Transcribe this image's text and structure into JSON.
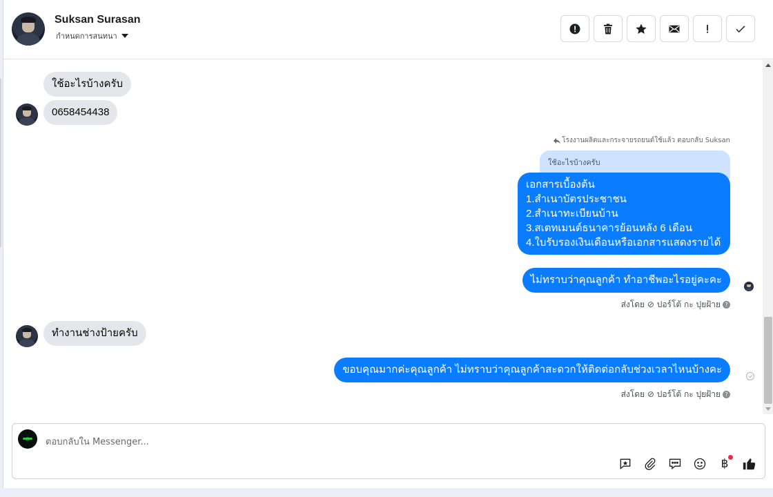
{
  "contact": {
    "name": "Suksan Surasan",
    "subtitle": "กำหนดการสนทนา"
  },
  "toolbar": [
    {
      "name": "report-icon",
      "label": "!"
    },
    {
      "name": "trash-icon",
      "label": ""
    },
    {
      "name": "star-icon",
      "label": ""
    },
    {
      "name": "mail-icon",
      "label": ""
    },
    {
      "name": "exclamation-icon",
      "label": "!"
    },
    {
      "name": "check-icon",
      "label": ""
    }
  ],
  "messages": {
    "in_1": "ใช้อะไรบ้างครับ",
    "in_2": "0658454438",
    "reply_note": "โรงงานผลิตและกระจายรถยนต์ใช้แล้ว ตอบกลับ Suksan",
    "quoted": "ใช้อะไรบ้างครับ",
    "docs": [
      "เอกสารเบื้องต้น",
      "1.สำเนาบัตรประชาชน",
      "2.สำเนาทะเบียนบ้าน",
      "3.สเตทเมนต์ธนาคารย้อนหลัง 6 เดือน",
      "4.ใบรับรองเงินเดือนหรือเอกสารแสดงรายได้"
    ],
    "out_2": "ไม่ทราบว่าคุณลูกค้า ทำอาชีพอะไรอยู่คะคะ",
    "meta_1": "ส่งโดย ⊘ ปอร์โต้ กะ ปุยฝ้าย",
    "in_3": "ทำงานช่างป้ายครับ",
    "out_3": "ขอบคุณมากค่ะคุณลูกค้า ไม่ทราบว่าคุณลูกค้าสะดวกให้ติดต่อกลับช่วงเวลาไหนบ้างคะ",
    "meta_2": "ส่งโดย ⊘ ปอร์โต้ กะ ปุยฝ้าย"
  },
  "composer": {
    "placeholder": "ตอบกลับใน Messenger...",
    "tools": [
      "saved-reply-icon",
      "attach-icon",
      "comment-icon",
      "emoji-icon",
      "baht-icon",
      "like-icon"
    ],
    "baht_glyph": "฿"
  },
  "colors": {
    "outgoing": "#0a7cff",
    "incoming": "#e4e6eb",
    "quoted": "#cfe2ff",
    "notification_dot": "#f02849"
  }
}
